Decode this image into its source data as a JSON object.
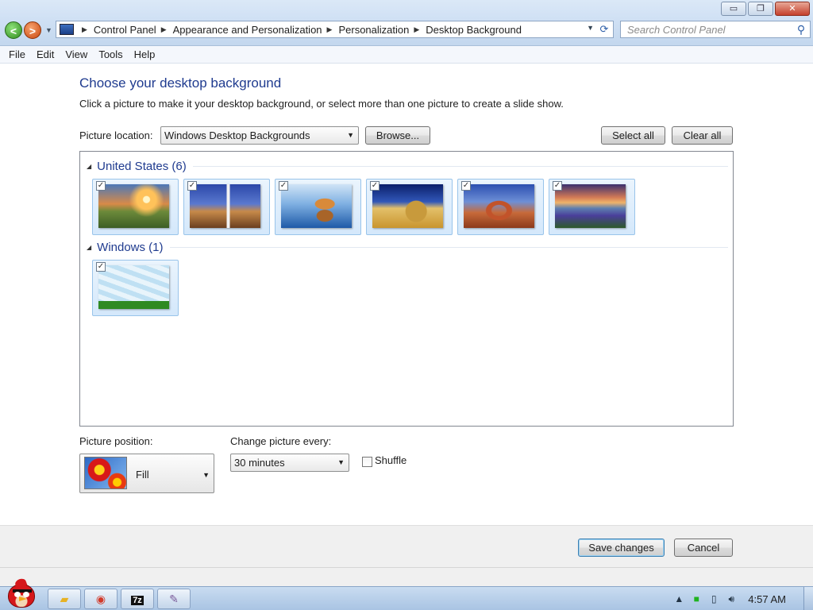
{
  "window": {
    "minimize": "▭",
    "maximize": "❐",
    "close": "✕"
  },
  "nav": {
    "back": "<",
    "forward": ">"
  },
  "address": {
    "crumbs": [
      "Control Panel",
      "Appearance and Personalization",
      "Personalization",
      "Desktop Background"
    ]
  },
  "search": {
    "placeholder": "Search Control Panel"
  },
  "menu": [
    "File",
    "Edit",
    "View",
    "Tools",
    "Help"
  ],
  "main": {
    "title": "Choose your desktop background",
    "subtitle": "Click a picture to make it your desktop background, or select more than one picture to create a slide show.",
    "picture_location_label": "Picture location:",
    "picture_location_value": "Windows Desktop Backgrounds",
    "browse_label": "Browse...",
    "select_all_label": "Select all",
    "clear_all_label": "Clear all",
    "groups": [
      {
        "title": "United States (6)",
        "items": [
          {
            "name": "sunset-farm",
            "checked": true
          },
          {
            "name": "lighthouse",
            "checked": true
          },
          {
            "name": "rock-reflection",
            "checked": true
          },
          {
            "name": "hay-bale",
            "checked": true
          },
          {
            "name": "delicate-arch",
            "checked": true
          },
          {
            "name": "lupine-lake",
            "checked": true
          }
        ]
      },
      {
        "title": "Windows (1)",
        "items": [
          {
            "name": "windows-cursor",
            "checked": true
          }
        ]
      }
    ],
    "picture_position_label": "Picture position:",
    "picture_position_value": "Fill",
    "change_every_label": "Change picture every:",
    "change_every_value": "30 minutes",
    "shuffle_label": "Shuffle",
    "shuffle_checked": false
  },
  "footer": {
    "save_label": "Save changes",
    "cancel_label": "Cancel"
  },
  "taskbar": {
    "clock": "4:57 AM"
  }
}
